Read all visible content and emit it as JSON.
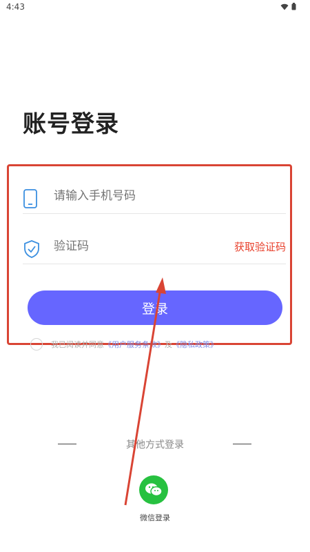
{
  "status_bar": {
    "time": "4:43",
    "wifi_icon": "wifi-icon",
    "battery_icon": "battery-icon"
  },
  "page": {
    "title": "账号登录"
  },
  "form": {
    "phone_placeholder": "请输入手机号码",
    "code_placeholder": "验证码",
    "get_code_label": "获取验证码",
    "login_label": "登录"
  },
  "agreement": {
    "prefix": "我已阅读并同意",
    "terms_link": "《用户服务条款》",
    "and": "及",
    "privacy_link": "《隐私政策》"
  },
  "other_login": {
    "label": "其他方式登录",
    "wechat_label": "微信登录"
  },
  "colors": {
    "accent": "#6666ff",
    "highlight": "#d94434",
    "code_link": "#e8402c",
    "wechat": "#27c140"
  }
}
